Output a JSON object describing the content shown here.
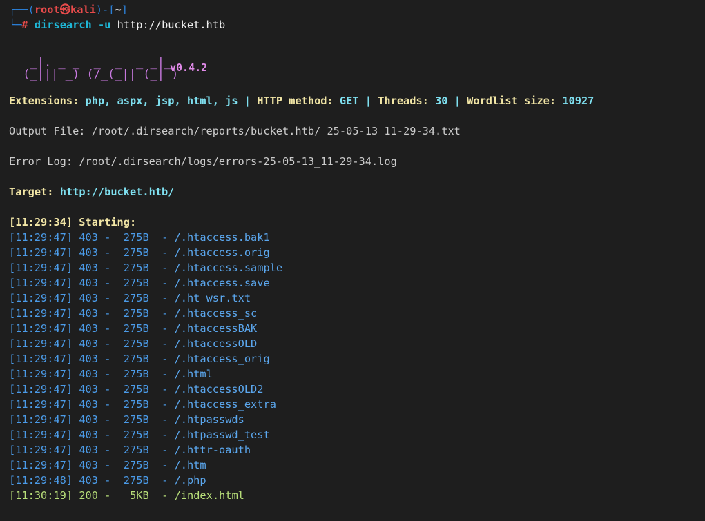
{
  "prompt": {
    "corner_top": "┌──(",
    "user": "root",
    "at_symbol": "㉿",
    "host": "kali",
    "mid": ")-[",
    "dir": "~",
    "end": "]",
    "corner_bottom": "└─",
    "hash": "#",
    "command": "dirsearch",
    "flag": "-u",
    "url": "http://bucket.htb"
  },
  "banner": {
    "art_line1": "  _|. _ _  _  _  _ _|_",
    "art_line2": " (_||| _) (/_(_|| (_| )",
    "version": "v0.4.2"
  },
  "config": {
    "ext_key": "Extensions: ",
    "ext_val": "php, aspx, jsp, html, js",
    "sep": " | ",
    "method_key": "HTTP method: ",
    "method_val": "GET",
    "threads_key": "Threads: ",
    "threads_val": "30",
    "wordlist_key": "Wordlist size: ",
    "wordlist_val": "10927"
  },
  "output_file": "Output File: /root/.dirsearch/reports/bucket.htb/_25-05-13_11-29-34.txt",
  "error_log": "Error Log: /root/.dirsearch/logs/errors-25-05-13_11-29-34.log",
  "target": {
    "label": "Target: ",
    "url": "http://bucket.htb/"
  },
  "starting": "[11:29:34] Starting:",
  "results": [
    {
      "time": "[11:29:47]",
      "code": "403",
      "size": "275B",
      "path": "/.htaccess.bak1"
    },
    {
      "time": "[11:29:47]",
      "code": "403",
      "size": "275B",
      "path": "/.htaccess.orig"
    },
    {
      "time": "[11:29:47]",
      "code": "403",
      "size": "275B",
      "path": "/.htaccess.sample"
    },
    {
      "time": "[11:29:47]",
      "code": "403",
      "size": "275B",
      "path": "/.htaccess.save"
    },
    {
      "time": "[11:29:47]",
      "code": "403",
      "size": "275B",
      "path": "/.ht_wsr.txt"
    },
    {
      "time": "[11:29:47]",
      "code": "403",
      "size": "275B",
      "path": "/.htaccess_sc"
    },
    {
      "time": "[11:29:47]",
      "code": "403",
      "size": "275B",
      "path": "/.htaccessBAK"
    },
    {
      "time": "[11:29:47]",
      "code": "403",
      "size": "275B",
      "path": "/.htaccessOLD"
    },
    {
      "time": "[11:29:47]",
      "code": "403",
      "size": "275B",
      "path": "/.htaccess_orig"
    },
    {
      "time": "[11:29:47]",
      "code": "403",
      "size": "275B",
      "path": "/.html"
    },
    {
      "time": "[11:29:47]",
      "code": "403",
      "size": "275B",
      "path": "/.htaccessOLD2"
    },
    {
      "time": "[11:29:47]",
      "code": "403",
      "size": "275B",
      "path": "/.htaccess_extra"
    },
    {
      "time": "[11:29:47]",
      "code": "403",
      "size": "275B",
      "path": "/.htpasswds"
    },
    {
      "time": "[11:29:47]",
      "code": "403",
      "size": "275B",
      "path": "/.htpasswd_test"
    },
    {
      "time": "[11:29:47]",
      "code": "403",
      "size": "275B",
      "path": "/.httr-oauth"
    },
    {
      "time": "[11:29:47]",
      "code": "403",
      "size": "275B",
      "path": "/.htm"
    },
    {
      "time": "[11:29:48]",
      "code": "403",
      "size": "275B",
      "path": "/.php"
    },
    {
      "time": "[11:30:19]",
      "code": "200",
      "size": "5KB",
      "path": "/index.html"
    }
  ],
  "result_dash": "-",
  "colors": {
    "background": "#1e1e1e",
    "prompt_frame": "#2b7fd6",
    "prompt_user": "#e84b4b",
    "banner": "#c678dd",
    "config_key": "#f2e6a6",
    "config_value": "#7fe0f0",
    "status_403": "#4b9be8",
    "status_200": "#b9e07a"
  }
}
